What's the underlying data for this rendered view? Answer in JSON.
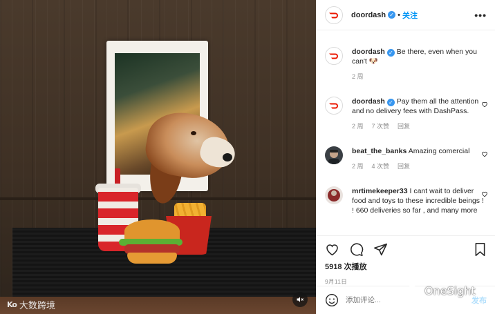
{
  "post": {
    "author": "doordash",
    "follow_label": "关注",
    "more_label": "•••"
  },
  "media": {
    "watermark_logo": "Ko",
    "watermark_text": "大数跨境",
    "mute_icon": "muted-speaker-icon"
  },
  "comments": [
    {
      "user": "doordash",
      "verified": true,
      "text": "Be there, even when you can't 🐶",
      "time": "2 周",
      "likes": "",
      "reply": ""
    },
    {
      "user": "doordash",
      "verified": true,
      "text": "Pay them all the attention and no delivery fees with DashPass.",
      "time": "2 周",
      "likes": "7 次赞",
      "reply": "回复"
    },
    {
      "user": "beat_the_banks",
      "verified": false,
      "text": "Amazing comercial",
      "time": "2 周",
      "likes": "4 次赞",
      "reply": "回复"
    },
    {
      "user": "mrtimekeeper33",
      "verified": false,
      "text": "I cant wait to deliver food and toys to these incredible beings ! ! 660 deliveries so far , and many more",
      "time": "",
      "likes": "",
      "reply": ""
    }
  ],
  "actions": {
    "views": "5918 次播放",
    "date": "9月11日"
  },
  "add_comment": {
    "placeholder": "添加评论...",
    "post_label": "发布"
  },
  "overlay": {
    "brand": "OneSight"
  },
  "colors": {
    "doordash_red": "#eb1700",
    "link_blue": "#0095f6",
    "muted_gray": "#8e8e8e"
  }
}
